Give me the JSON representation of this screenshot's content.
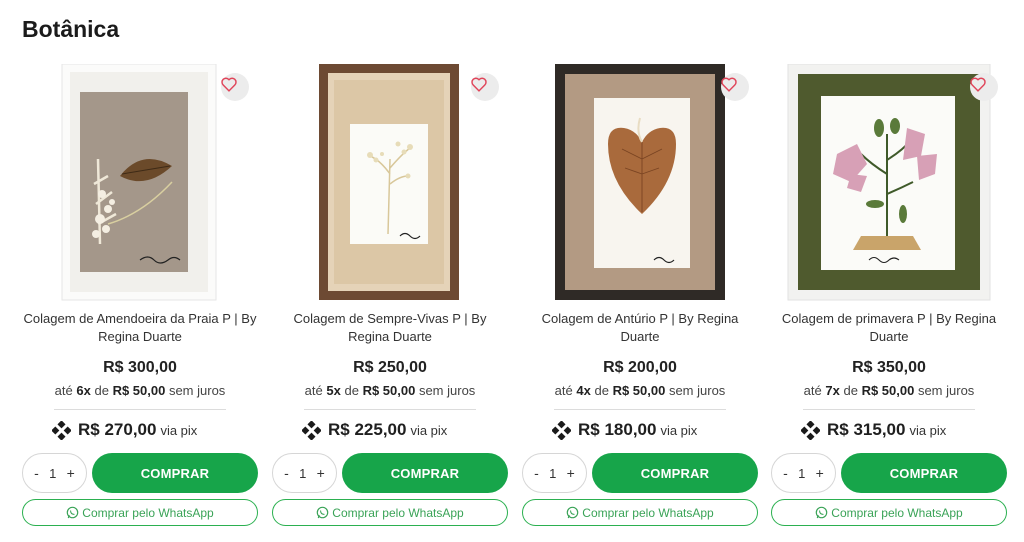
{
  "section": {
    "title": "Botânica"
  },
  "icons": {
    "wishlist": "heart-outline-icon",
    "pix": "pix-icon",
    "whatsapp": "whatsapp-icon"
  },
  "colors": {
    "buy_button": "#17a54a",
    "wishlist_icon": "#e0455a",
    "whatsapp": "#2bb050"
  },
  "products": [
    {
      "name": "Colagem de Amendoeira da Praia P | By Regina Duarte",
      "price": "R$ 300,00",
      "installments": {
        "prefix": "até",
        "count": "6x",
        "mid": "de",
        "amount": "R$ 50,00",
        "suffix": "sem juros"
      },
      "pix_price": "R$ 270,00",
      "pix_label": "via pix",
      "qty_minus": "-",
      "qty": "1",
      "qty_plus": "+",
      "buy_label": "COMPRAR",
      "whatsapp_label": "Comprar pelo WhatsApp"
    },
    {
      "name": "Colagem de Sempre-Vivas P | By Regina Duarte",
      "price": "R$ 250,00",
      "installments": {
        "prefix": "até",
        "count": "5x",
        "mid": "de",
        "amount": "R$ 50,00",
        "suffix": "sem juros"
      },
      "pix_price": "R$ 225,00",
      "pix_label": "via pix",
      "qty_minus": "-",
      "qty": "1",
      "qty_plus": "+",
      "buy_label": "COMPRAR",
      "whatsapp_label": "Comprar pelo WhatsApp"
    },
    {
      "name": "Colagem de Antúrio P | By Regina Duarte",
      "price": "R$ 200,00",
      "installments": {
        "prefix": "até",
        "count": "4x",
        "mid": "de",
        "amount": "R$ 50,00",
        "suffix": "sem juros"
      },
      "pix_price": "R$ 180,00",
      "pix_label": "via pix",
      "qty_minus": "-",
      "qty": "1",
      "qty_plus": "+",
      "buy_label": "COMPRAR",
      "whatsapp_label": "Comprar pelo WhatsApp"
    },
    {
      "name": "Colagem de primavera P | By Regina Duarte",
      "price": "R$ 350,00",
      "installments": {
        "prefix": "até",
        "count": "7x",
        "mid": "de",
        "amount": "R$ 50,00",
        "suffix": "sem juros"
      },
      "pix_price": "R$ 315,00",
      "pix_label": "via pix",
      "qty_minus": "-",
      "qty": "1",
      "qty_plus": "+",
      "buy_label": "COMPRAR",
      "whatsapp_label": "Comprar pelo WhatsApp"
    }
  ]
}
